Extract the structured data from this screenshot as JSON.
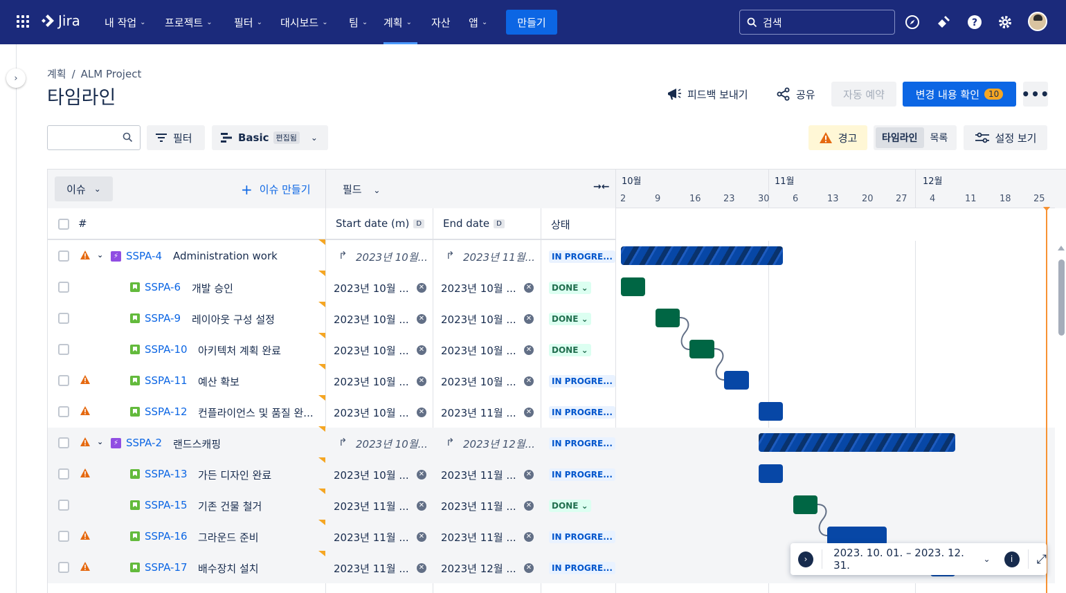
{
  "nav": {
    "logo": "Jira",
    "items": [
      {
        "label": "내 작업",
        "chev": true
      },
      {
        "label": "프로젝트",
        "chev": true
      },
      {
        "label": "필터",
        "chev": true
      },
      {
        "label": "대시보드",
        "chev": true
      },
      {
        "label": "팀",
        "chev": true
      },
      {
        "label": "계획",
        "chev": true
      },
      {
        "label": "자산",
        "chev": false
      },
      {
        "label": "앱",
        "chev": true
      }
    ],
    "create": "만들기",
    "search_placeholder": "검색"
  },
  "breadcrumb": {
    "root": "계획",
    "sep": "/",
    "project": "ALM Project"
  },
  "page_title": "타임라인",
  "header": {
    "feedback": "피드백 보내기",
    "share": "공유",
    "auto_schedule": "자동 예약",
    "review_changes": "변경 내용 확인",
    "changes_count": "10"
  },
  "toolbar": {
    "filter": "필터",
    "view": "Basic",
    "edited": "편집됨",
    "warnings": "경고",
    "timeline": "타임라인",
    "list": "목록",
    "view_settings": "설정 보기"
  },
  "table": {
    "issue_selector": "이슈",
    "create_issue": "이슈 만들기",
    "fields": "필드",
    "col_hash": "#",
    "col_start": "Start date (m)",
    "col_end": "End date",
    "col_badge": "D",
    "col_status": "상태"
  },
  "timeline": {
    "months": [
      "10월",
      "11월",
      "12월"
    ],
    "days": [
      "2",
      "9",
      "16",
      "23",
      "30",
      "6",
      "13",
      "20",
      "27",
      "4",
      "11",
      "18",
      "25"
    ]
  },
  "rows": [
    {
      "key": "SSPA-4",
      "summary": "Administration work",
      "type": "epic",
      "warn": true,
      "start": "2023년 10월...",
      "end": "2023년 11월...",
      "rollup": true,
      "status": "IN PROGRE...",
      "status_type": "prog"
    },
    {
      "key": "SSPA-6",
      "summary": "개발 승인",
      "type": "story",
      "warn": false,
      "start": "2023년 10월 ...",
      "end": "2023년 10월 ...",
      "rollup": false,
      "status": "DONE",
      "status_type": "done"
    },
    {
      "key": "SSPA-9",
      "summary": "레이아웃 구성 설정",
      "type": "story",
      "warn": false,
      "start": "2023년 10월 ...",
      "end": "2023년 10월 ...",
      "rollup": false,
      "status": "DONE",
      "status_type": "done"
    },
    {
      "key": "SSPA-10",
      "summary": "아키텍처 계획 완료",
      "type": "story",
      "warn": false,
      "start": "2023년 10월 ...",
      "end": "2023년 10월 ...",
      "rollup": false,
      "status": "DONE",
      "status_type": "done"
    },
    {
      "key": "SSPA-11",
      "summary": "예산 확보",
      "type": "story",
      "warn": true,
      "start": "2023년 10월 ...",
      "end": "2023년 10월 ...",
      "rollup": false,
      "status": "IN PROGRE...",
      "status_type": "prog"
    },
    {
      "key": "SSPA-12",
      "summary": "컨플라이언스 및 품질 완...",
      "type": "story",
      "warn": true,
      "start": "2023년 10월 ...",
      "end": "2023년 11월 ...",
      "rollup": false,
      "status": "IN PROGRE...",
      "status_type": "prog"
    },
    {
      "key": "SSPA-2",
      "summary": "랜드스캐핑",
      "type": "epic",
      "warn": true,
      "start": "2023년 10월...",
      "end": "2023년 12월...",
      "rollup": true,
      "status": "IN PROGRE...",
      "status_type": "prog"
    },
    {
      "key": "SSPA-13",
      "summary": "가든 디자인 완료",
      "type": "story",
      "warn": true,
      "start": "2023년 10월 ...",
      "end": "2023년 11월 ...",
      "rollup": false,
      "status": "IN PROGRE...",
      "status_type": "prog"
    },
    {
      "key": "SSPA-15",
      "summary": "기존 건물 철거",
      "type": "story",
      "warn": false,
      "start": "2023년 11월 ...",
      "end": "2023년 11월 ...",
      "rollup": false,
      "status": "DONE",
      "status_type": "done"
    },
    {
      "key": "SSPA-16",
      "summary": "그라운드 준비",
      "type": "story",
      "warn": true,
      "start": "2023년 11월 ...",
      "end": "2023년 11월 ...",
      "rollup": false,
      "status": "IN PROGRE...",
      "status_type": "prog"
    },
    {
      "key": "SSPA-17",
      "summary": "배수장치 설치",
      "type": "story",
      "warn": true,
      "start": "2023년 11월 ...",
      "end": "2023년 12월 ...",
      "rollup": false,
      "status": "IN PROGRE...",
      "status_type": "prog"
    }
  ],
  "date_range": "2023. 10. 01. – 2023. 12. 31."
}
